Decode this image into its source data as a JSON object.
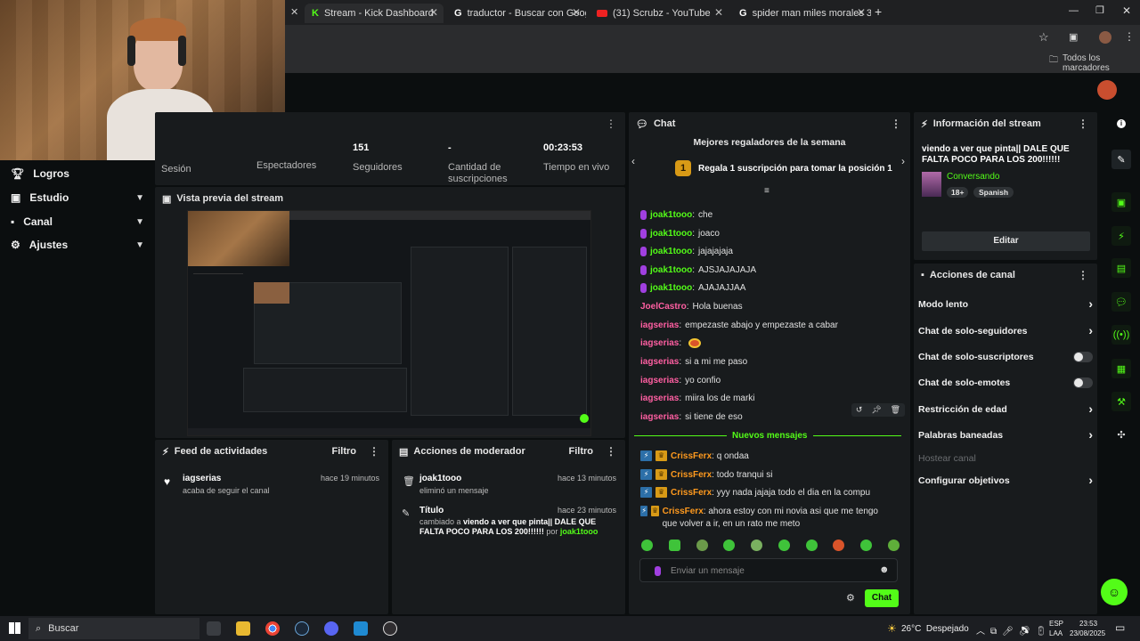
{
  "browser": {
    "tabs": [
      {
        "title": "Stream - Kick Dashboard",
        "icon": "kick-icon"
      },
      {
        "title": "traductor - Buscar con Google",
        "icon": "google-icon"
      },
      {
        "title": "(31) Scrubz - YouTube",
        "icon": "youtube-icon"
      },
      {
        "title": "spider man miles morales 3 - B",
        "icon": "google-icon"
      }
    ],
    "bookmarks_label": "Todos los marcadores"
  },
  "sidebar": {
    "items": [
      {
        "label": "Logros",
        "icon": "trophy-icon",
        "expandable": false
      },
      {
        "label": "Estudio",
        "icon": "studio-icon",
        "expandable": true
      },
      {
        "label": "Canal",
        "icon": "channel-icon",
        "expandable": true
      },
      {
        "label": "Ajustes",
        "icon": "gear-icon",
        "expandable": true
      }
    ]
  },
  "stats": {
    "session_label": "Sesión",
    "viewers_label": "Espectadores",
    "followers_value": "151",
    "followers_label": "Seguidores",
    "subs_value": "-",
    "subs_label": "Cantidad de suscripciones",
    "time_value": "00:23:53",
    "time_label": "Tiempo en vivo"
  },
  "preview": {
    "title": "Vista previa del stream"
  },
  "activity_feed": {
    "title": "Feed de actividades",
    "filter": "Filtro",
    "items": [
      {
        "user": "iagserias",
        "text": "acaba de seguir el canal",
        "time": "hace 19 minutos"
      }
    ]
  },
  "mod_actions": {
    "title": "Acciones de moderador",
    "filter": "Filtro",
    "items": [
      {
        "user": "joak1tooo",
        "text": "eliminó un mensaje",
        "time": "hace 13 minutos"
      },
      {
        "user": "Título",
        "prefix": "cambiado a",
        "value": "viendo a ver que pinta|| DALE QUE FALTA POCO PARA LOS 200!!!!!!",
        "by": "por",
        "by_user": "joak1tooo",
        "time": "hace 23 minutos"
      }
    ]
  },
  "chat": {
    "title": "Chat",
    "top_gifters_title": "Mejores regaladores de la semana",
    "rank": "1",
    "gift_cta": "Regala 1 suscripción para tomar la posición 1",
    "messages": [
      {
        "user": "joak1tooo",
        "text": "che",
        "color": "green",
        "mic": true
      },
      {
        "user": "joak1tooo",
        "text": "joaco",
        "color": "green",
        "mic": true
      },
      {
        "user": "joak1tooo",
        "text": "jajajajaja",
        "color": "green",
        "mic": true
      },
      {
        "user": "joak1tooo",
        "text": "AJSJAJAJAJA",
        "color": "green",
        "mic": true
      },
      {
        "user": "joak1tooo",
        "text": "AJAJAJJAA",
        "color": "green",
        "mic": true
      },
      {
        "user": "JoelCastro",
        "text": "Hola buenas",
        "color": "pink",
        "mic": false
      },
      {
        "user": "iagserias",
        "text": "empezaste abajo y empezaste a cabar",
        "color": "pink",
        "mic": false
      },
      {
        "user": "iagserias",
        "text": "",
        "color": "pink",
        "mic": false,
        "emote": true
      },
      {
        "user": "iagserias",
        "text": "si a mi me paso",
        "color": "pink",
        "mic": false
      },
      {
        "user": "iagserias",
        "text": "yo confio",
        "color": "pink",
        "mic": false
      },
      {
        "user": "iagserias",
        "text": "miira los de marki",
        "color": "pink",
        "mic": false
      },
      {
        "user": "iagserias",
        "text": "si tiene de eso",
        "color": "pink",
        "mic": false
      }
    ],
    "new_messages_label": "Nuevos mensajes",
    "new_messages": [
      {
        "user": "CrissFerx",
        "text": "q ondaa"
      },
      {
        "user": "CrissFerx",
        "text": "todo tranqui si"
      },
      {
        "user": "CrissFerx",
        "text": "yyy nada jajaja todo el dia en la compu"
      },
      {
        "user": "CrissFerx",
        "text": "ahora estoy con mi novia asi que me tengo que volver a ir, en un rato me meto"
      }
    ],
    "input_placeholder": "Enviar un mensaje",
    "send_label": "Chat"
  },
  "stream_info": {
    "title": "Información del stream",
    "stream_title": "viendo a ver que pinta|| DALE QUE FALTA POCO PARA LOS 200!!!!!!",
    "category": "Conversando",
    "tags": [
      "18+",
      "Spanish"
    ],
    "edit_label": "Editar"
  },
  "channel_actions": {
    "title": "Acciones de canal",
    "items": [
      {
        "label": "Modo lento",
        "control": "chevron"
      },
      {
        "label": "Chat de solo-seguidores",
        "control": "chevron"
      },
      {
        "label": "Chat de solo-suscriptores",
        "control": "toggle"
      },
      {
        "label": "Chat de solo-emotes",
        "control": "toggle"
      },
      {
        "label": "Restricción de edad",
        "control": "chevron"
      },
      {
        "label": "Palabras baneadas",
        "control": "chevron"
      },
      {
        "label": "Hostear canal",
        "control": "none",
        "disabled": true
      },
      {
        "label": "Configurar objetivos",
        "control": "chevron"
      }
    ]
  },
  "taskbar": {
    "search_placeholder": "Buscar",
    "weather": "26°C  Despejado",
    "lang_top": "ESP",
    "lang_bottom": "LAA",
    "time": "23:53",
    "date": "23/08/2025"
  },
  "colors": {
    "accent": "#53fc18",
    "background": "#0b0e0f",
    "panel": "#181b1d",
    "pink_user": "#ff5fa2",
    "orange_user": "#ff9a1e"
  }
}
